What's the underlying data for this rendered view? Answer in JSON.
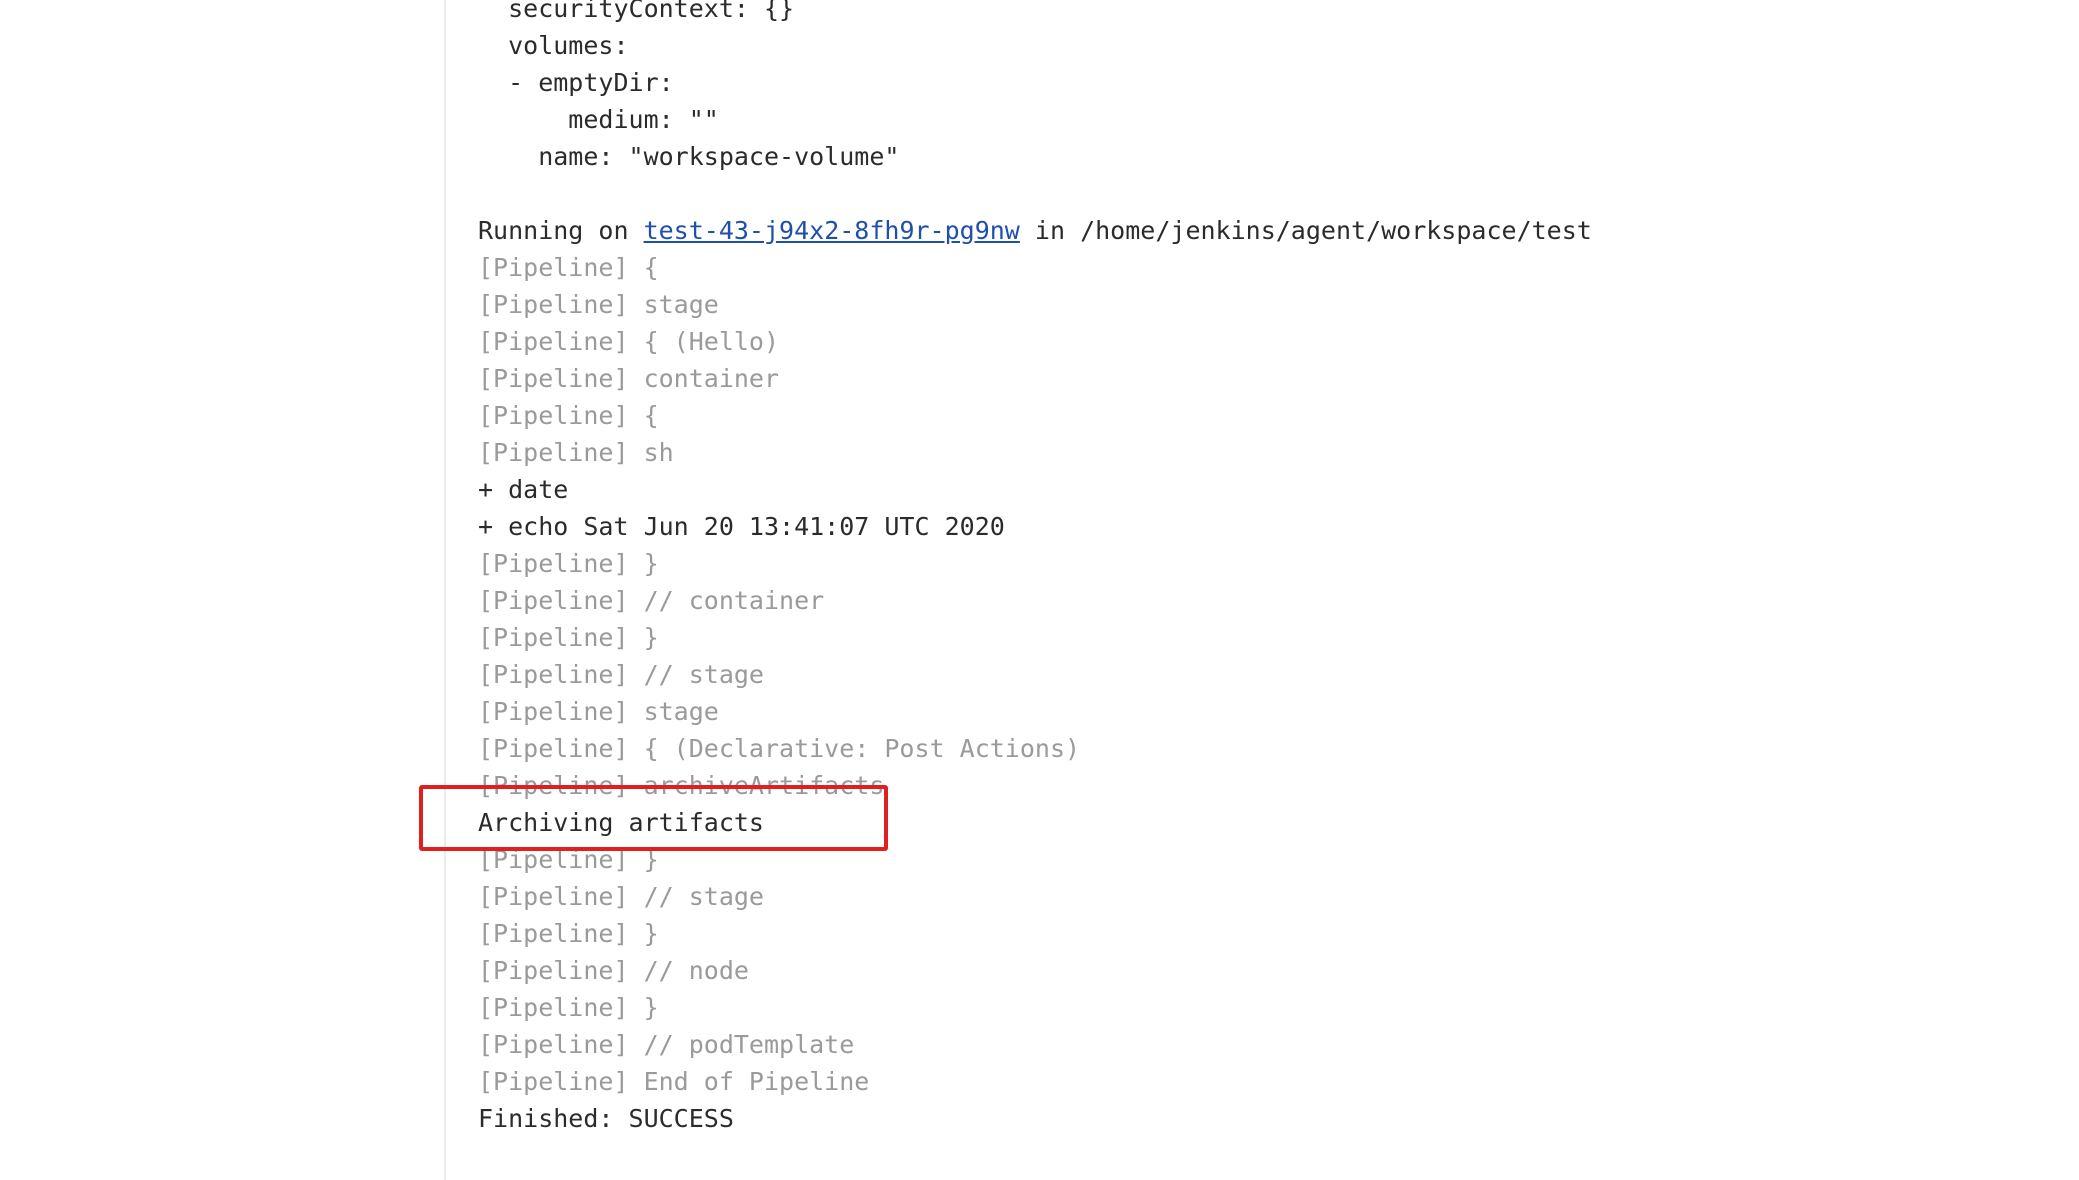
{
  "console": {
    "yaml_lines": [
      "  securityContext: {}",
      "  volumes:",
      "  - emptyDir:",
      "      medium: \"\"",
      "    name: \"workspace-volume\"",
      ""
    ],
    "running_on": {
      "prefix": "Running on ",
      "node_link": "test-43-j94x2-8fh9r-pg9nw",
      "suffix": " in /home/jenkins/agent/workspace/test"
    },
    "log_lines": [
      {
        "text": "[Pipeline] {",
        "style": "dim"
      },
      {
        "text": "[Pipeline] stage",
        "style": "dim"
      },
      {
        "text": "[Pipeline] { (Hello)",
        "style": "dim"
      },
      {
        "text": "[Pipeline] container",
        "style": "dim"
      },
      {
        "text": "[Pipeline] {",
        "style": "dim"
      },
      {
        "text": "[Pipeline] sh",
        "style": "dim"
      },
      {
        "text": "+ date",
        "style": "normal"
      },
      {
        "text": "+ echo Sat Jun 20 13:41:07 UTC 2020",
        "style": "normal"
      },
      {
        "text": "[Pipeline] }",
        "style": "dim"
      },
      {
        "text": "[Pipeline] // container",
        "style": "dim"
      },
      {
        "text": "[Pipeline] }",
        "style": "dim"
      },
      {
        "text": "[Pipeline] // stage",
        "style": "dim"
      },
      {
        "text": "[Pipeline] stage",
        "style": "dim"
      },
      {
        "text": "[Pipeline] { (Declarative: Post Actions)",
        "style": "dim"
      },
      {
        "text": "[Pipeline] archiveArtifacts",
        "style": "dim"
      },
      {
        "text": "Archiving artifacts",
        "style": "normal"
      },
      {
        "text": "[Pipeline] }",
        "style": "dim"
      },
      {
        "text": "[Pipeline] // stage",
        "style": "dim"
      },
      {
        "text": "[Pipeline] }",
        "style": "dim"
      },
      {
        "text": "[Pipeline] // node",
        "style": "dim"
      },
      {
        "text": "[Pipeline] }",
        "style": "dim"
      },
      {
        "text": "[Pipeline] // podTemplate",
        "style": "dim"
      },
      {
        "text": "[Pipeline] End of Pipeline",
        "style": "dim"
      },
      {
        "text": "Finished: SUCCESS",
        "style": "normal"
      }
    ]
  },
  "colors": {
    "log_text": "#2b2b2b",
    "pipeline_text": "#9a9a9a",
    "link": "#1f4fae",
    "highlight_border": "#e02020"
  }
}
